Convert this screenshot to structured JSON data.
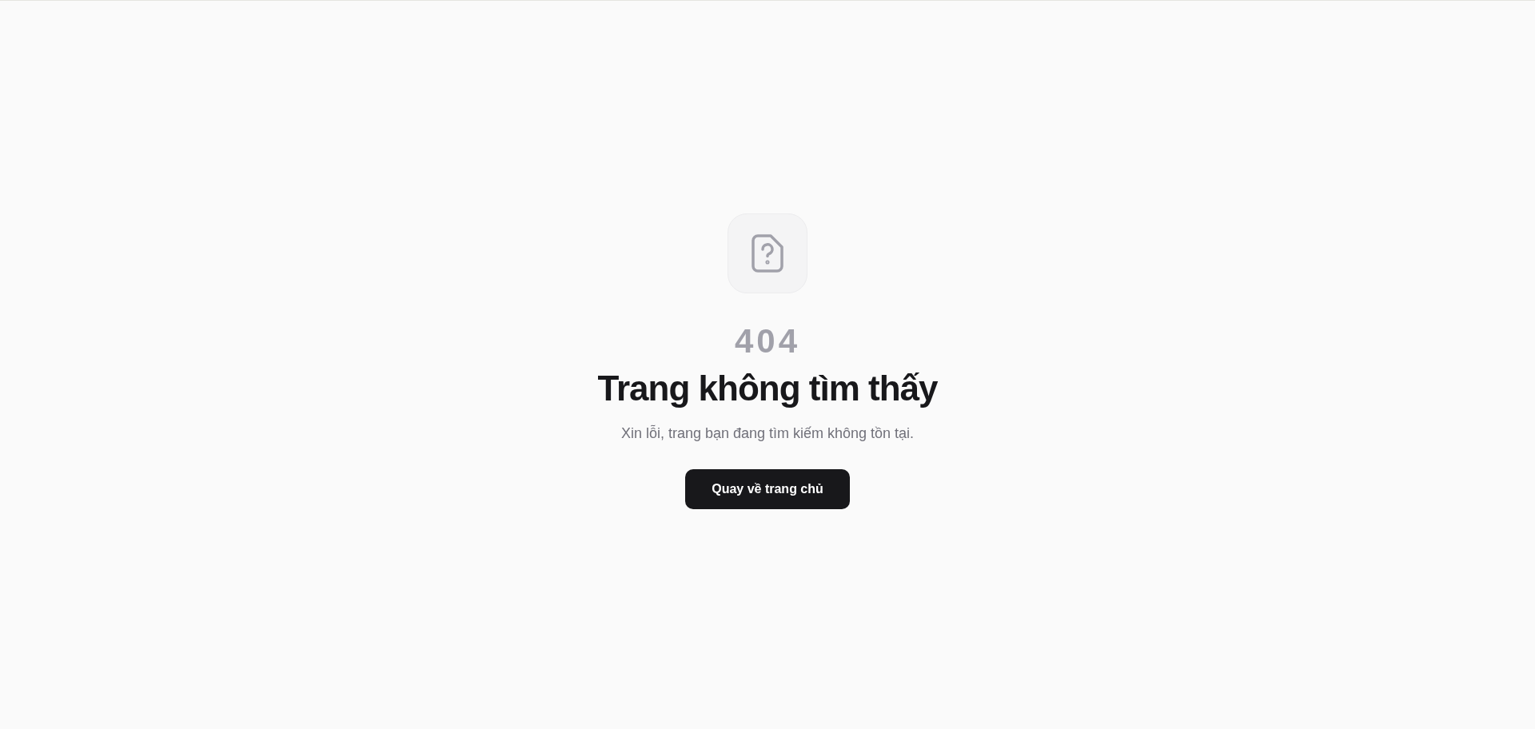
{
  "code": "404",
  "title": "Trang không tìm thấy",
  "message": "Xin lỗi, trang bạn đang tìm kiếm không tồn tại.",
  "button": {
    "label": "Quay về trang chủ"
  }
}
